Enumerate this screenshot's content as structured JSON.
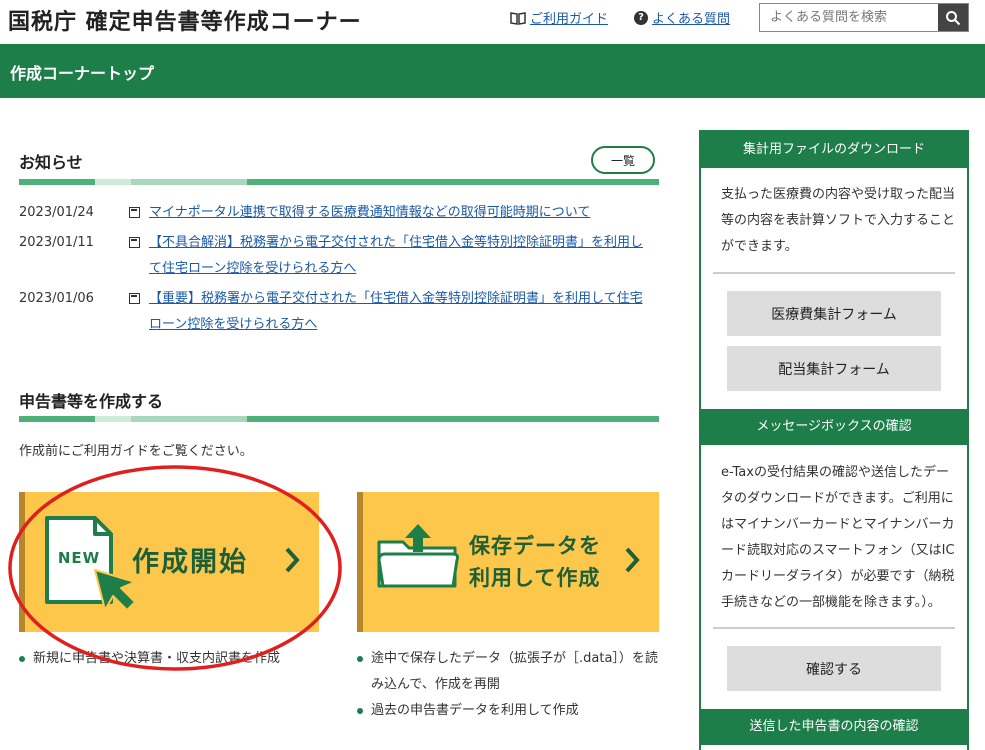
{
  "header": {
    "site_title": "国税庁 確定申告書等作成コーナー",
    "guide_link": "ご利用ガイド",
    "faq_link": "よくある質問",
    "search_placeholder": "よくある質問を検索"
  },
  "topbar": {
    "title": "作成コーナートップ"
  },
  "news": {
    "heading": "お知らせ",
    "list_button": "一覧",
    "items": [
      {
        "date": "2023/01/24",
        "text": "マイナポータル連携で取得する医療費通知情報などの取得可能時期について"
      },
      {
        "date": "2023/01/11",
        "text": "【不具合解消】税務署から電子交付された「住宅借入金等特別控除証明書」を利用して住宅ローン控除を受けられる方へ"
      },
      {
        "date": "2023/01/06",
        "text": "【重要】税務署から電子交付された「住宅借入金等特別控除証明書」を利用して住宅ローン控除を受けられる方へ"
      }
    ]
  },
  "create_section": {
    "heading": "申告書等を作成する",
    "intro": "作成前にご利用ガイドをご覧ください。",
    "create_button": {
      "badge": "NEW",
      "label": "作成開始"
    },
    "create_bullets": [
      "新規に申告書や決算書・収支内訳書を作成"
    ],
    "resume_button": {
      "line1": "保存データを",
      "line2": "利用して作成"
    },
    "resume_bullets": [
      "途中で保存したデータ（拡張子が［.data］）を読み込んで、作成を再開",
      "過去の申告書データを利用して作成"
    ]
  },
  "sidebar": {
    "download": {
      "heading": "集計用ファイルのダウンロード",
      "text": "支払った医療費の内容や受け取った配当等の内容を表計算ソフトで入力することができます。",
      "buttons": [
        "医療費集計フォーム",
        "配当集計フォーム"
      ]
    },
    "messagebox": {
      "heading": "メッセージボックスの確認",
      "text": "e-Taxの受付結果の確認や送信したデータのダウンロードができます。ご利用にはマイナンバーカードとマイナンバーカード読取対応のスマートフォン（又はICカードリーダライタ）が必要です（納税手続きなどの一部機能を除きます。）。",
      "button": "確認する"
    },
    "next_heading": "送信した申告書の内容の確認"
  },
  "colors": {
    "brand_green": "#1e7e4a",
    "button_yellow": "#fcc74a",
    "annotation_red": "#e02020",
    "link_blue": "#1a5aa8"
  }
}
